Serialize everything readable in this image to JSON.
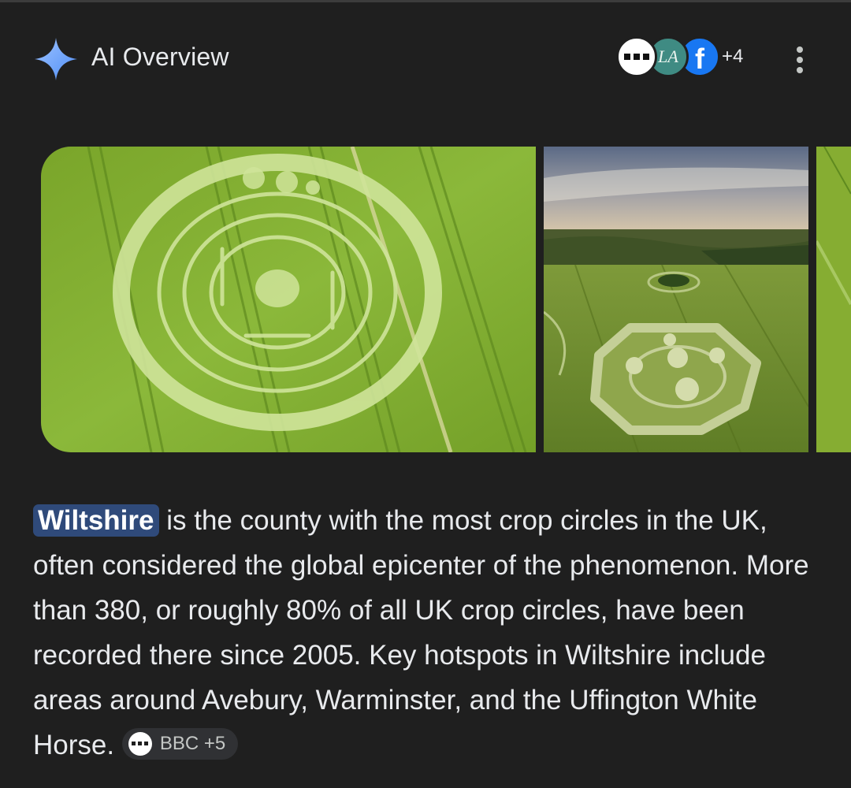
{
  "header": {
    "title": "AI Overview",
    "sources_more": "+4",
    "avatar_2_text": "LA",
    "avatar_3_text": "f",
    "accent_color": "#8ab4f8"
  },
  "images": [
    {
      "name": "crop-circle-concentric-rings"
    },
    {
      "name": "crop-circle-octagon-field"
    },
    {
      "name": "crop-field-partial"
    }
  ],
  "answer": {
    "highlight": "Wiltshire",
    "text": " is the county with the most crop circles in the UK, often considered the global epicenter of the phenomenon. More than 380, or roughly 80% of all UK crop circles, have been recorded there since 2005. Key hotspots in Wiltshire include areas around Avebury, Warminster, and the Uffington White Horse. ",
    "source_chip": "BBC +5"
  }
}
